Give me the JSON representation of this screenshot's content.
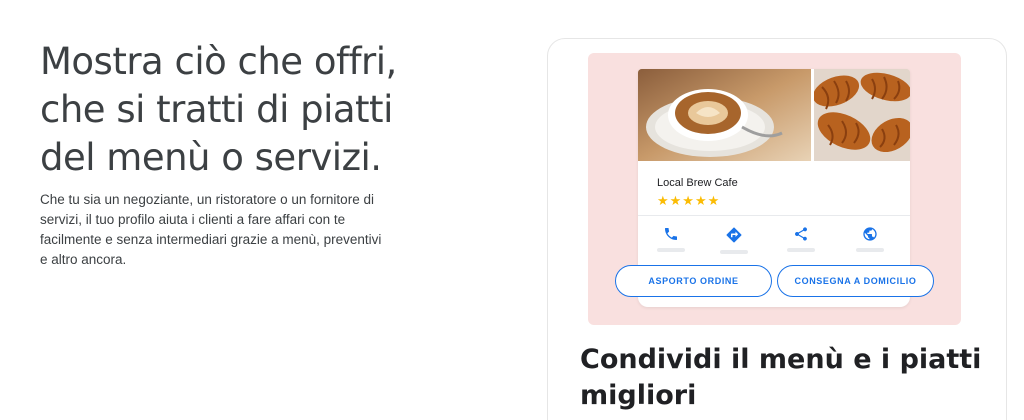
{
  "hero": {
    "headline_lines": [
      "Mostra ciò che offri,",
      "che si tratti di piatti",
      "del menù o servizi."
    ],
    "body": "Che tu sia un negoziante, un ristoratore o un fornitore di servizi, il tuo profilo aiuta i clienti a fare affari con te facilmente e senza intermediari grazie a menù, preventivi e altro ancora."
  },
  "card": {
    "business_name": "Local Brew Cafe",
    "rating_stars": 5,
    "stars_text": "★★★★★",
    "actions": [
      {
        "icon": "phone-icon"
      },
      {
        "icon": "directions-icon"
      },
      {
        "icon": "share-icon"
      },
      {
        "icon": "globe-icon"
      }
    ],
    "buttons": {
      "takeout": "ASPORTO ORDINE",
      "delivery": "CONSEGNA A DOMICILIO"
    },
    "title": "Condividi il menù e i piatti migliori"
  },
  "colors": {
    "accent_blue": "#1a73e8",
    "star_yellow": "#fbbc04",
    "illustration_bg": "#f9e0df"
  }
}
